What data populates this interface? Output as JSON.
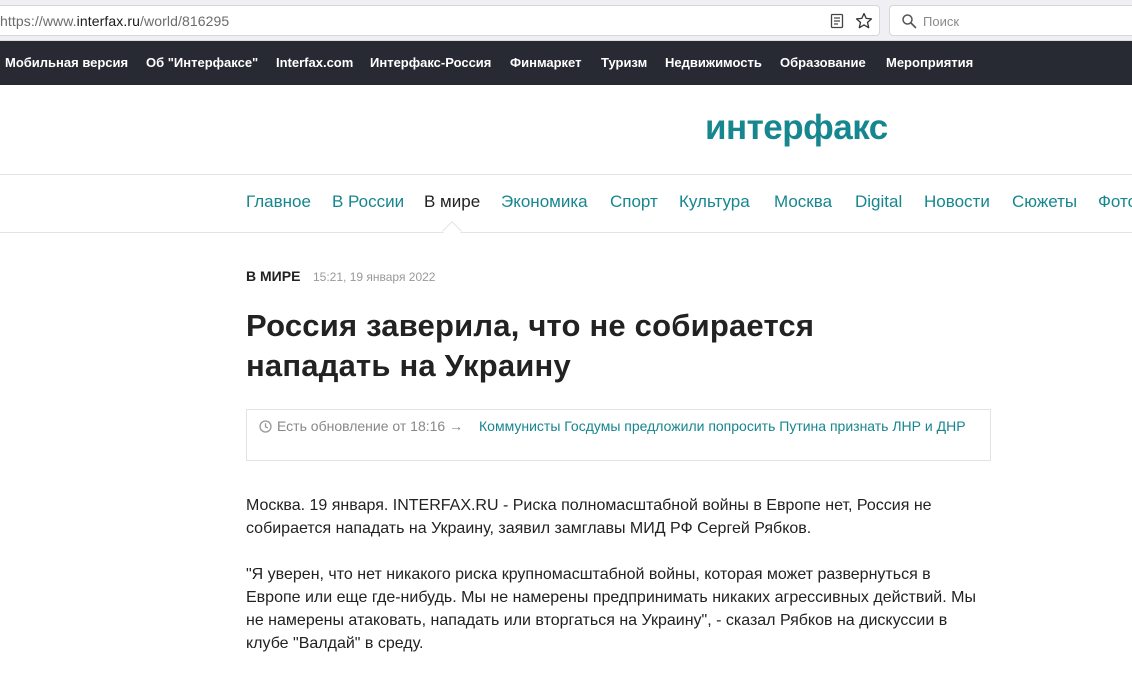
{
  "browser": {
    "url_prefix": "https://www.",
    "url_domain": "interfax.ru",
    "url_path": "/world/816295",
    "search_placeholder": "Поиск"
  },
  "topnav": {
    "items": [
      {
        "label": "Мобильная версия"
      },
      {
        "label": "Об \"Интерфаксе\""
      },
      {
        "label": "Interfax.com"
      },
      {
        "label": "Интерфакс-Россия"
      },
      {
        "label": "Финмаркет"
      },
      {
        "label": "Туризм"
      },
      {
        "label": "Недвижимость"
      },
      {
        "label": "Образование"
      },
      {
        "label": "Мероприятия"
      }
    ]
  },
  "logo": {
    "text": "интерфакс",
    "color": "#16868f"
  },
  "sectionnav": {
    "items": [
      {
        "label": "Главное"
      },
      {
        "label": "В России"
      },
      {
        "label": "В мире",
        "active": true
      },
      {
        "label": "Экономика"
      },
      {
        "label": "Спорт"
      },
      {
        "label": "Культура"
      },
      {
        "label": "Москва"
      },
      {
        "label": "Digital"
      },
      {
        "label": "Новости"
      },
      {
        "label": "Сюжеты"
      },
      {
        "label": "Фото"
      }
    ]
  },
  "article": {
    "rubric": "В МИРЕ",
    "datetime": "15:21, 19 января 2022",
    "headline": "Россия заверила, что не собирается нападать на Украину",
    "update": {
      "label": "Есть обновление от 18:16 →",
      "link": "Коммунисты Госдумы предложили попросить Путина признать ЛНР и ДНР"
    },
    "paragraphs": [
      "Москва. 19 января. INTERFAX.RU - Риска полномасштабной войны в Европе нет, Россия не собирается нападать на Украину, заявил замглавы МИД РФ Сергей Рябков.",
      "\"Я уверен, что нет никакого риска крупномасштабной войны, которая может развернуться в Европе или еще где-нибудь. Мы не намерены предпринимать никаких агрессивных действий. Мы не намерены атаковать, нападать или вторгаться на Украину\", - сказал Рябков на дискуссии в клубе \"Валдай\" в среду."
    ]
  },
  "colors": {
    "accent": "#16868f",
    "topnav_bg": "#272a33",
    "text": "#222222"
  }
}
